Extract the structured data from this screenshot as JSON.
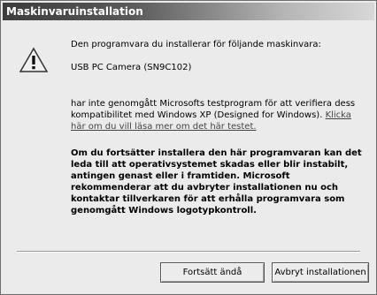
{
  "window": {
    "title": "Maskinvaruinstallation"
  },
  "icon": {
    "name": "warning-icon"
  },
  "message": {
    "lead": "Den programvara du installerar för följande maskinvara:",
    "device": "USB PC Camera (SN9C102)",
    "not_tested_text": "har inte genomgått Microsofts testprogram för att verifiera dess kompatibilitet med Windows XP (Designed for Windows). ",
    "link_text": "Klicka här om du vill läsa mer om det här testet.",
    "warning_bold": "Om du fortsätter installera den här programvaran kan det leda till att operativsystemet skadas eller blir instabilt, antingen genast eller i framtiden. Microsoft rekommenderar att du avbryter installationen nu och kontaktar tillverkaren för att erhålla programvara som genomgått Windows logotypkontroll."
  },
  "buttons": {
    "continue_label": "Fortsätt ändå",
    "stop_label": "Avbryt installationen"
  }
}
